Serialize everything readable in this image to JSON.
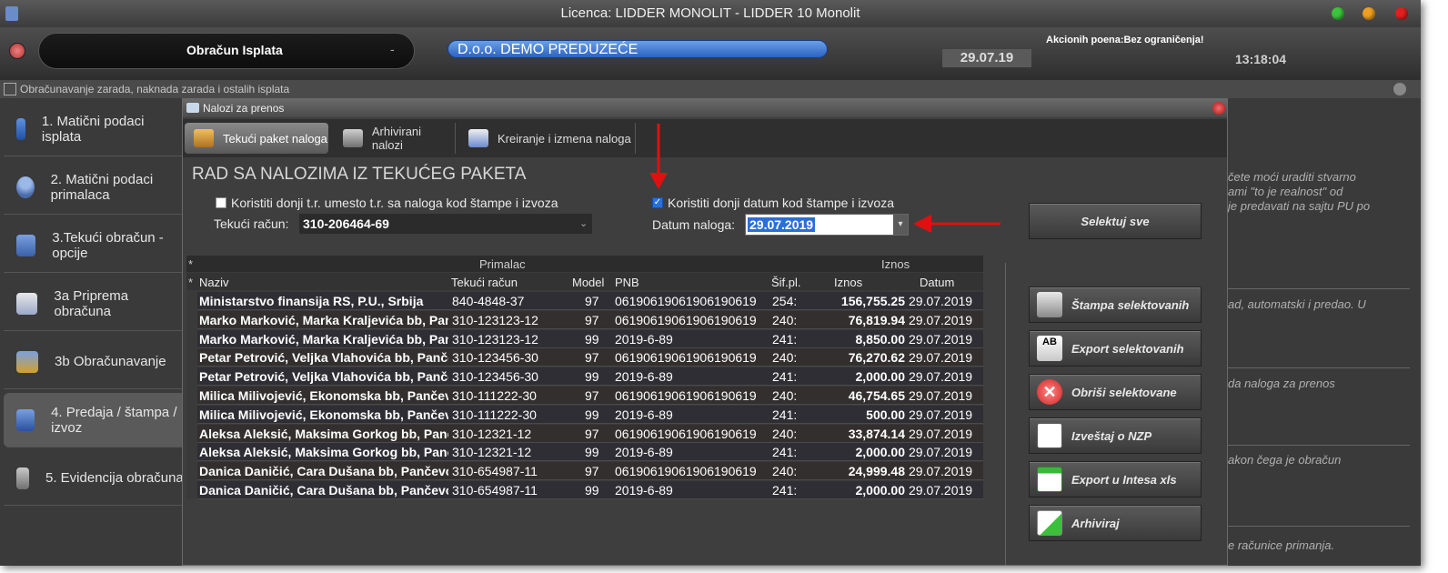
{
  "window": {
    "title": "Licenca: LIDDER MONOLIT - LIDDER 10 Monolit"
  },
  "toolbar": {
    "module": "Obračun Isplata",
    "module_dash": "-",
    "company": "D.o.o. DEMO PREDUZEĆE",
    "date": "29.07.19",
    "akcioni": "Akcionih poena:Bez ograničenja!",
    "clock": "13:18:04"
  },
  "subbar": {
    "title": "Obračunavanje zarada, naknada zarada i ostalih isplata"
  },
  "menu": {
    "items": [
      {
        "label": "1. Matični podaci isplata"
      },
      {
        "label": "2. Matični podaci primalaca"
      },
      {
        "label": "3.Tekući obračun - opcije"
      },
      {
        "label": "3a Priprema obračuna"
      },
      {
        "label": "3b Obračunavanje"
      },
      {
        "label": "4. Predaja / štampa / izvoz"
      },
      {
        "label": "5. Evidencija obračuna"
      }
    ]
  },
  "hints": [
    "čete moći uraditi stvarno",
    "ami \"to je realnost\" od",
    "je predavati na sajtu PU po",
    "ad, automatski i predao. U",
    "da naloga za prenos",
    "akon čega je obračun",
    "e računice primanja."
  ],
  "dialog": {
    "title": "Nalozi za prenos",
    "tabs": [
      {
        "label": "Tekući paket naloga"
      },
      {
        "label": "Arhivirani nalozi"
      },
      {
        "label": "Kreiranje i izmena naloga"
      }
    ],
    "section_title": "RAD SA NALOZIMA IZ TEKUĆEG PAKETA",
    "chk_account": "Koristiti donji t.r. umesto t.r. sa naloga kod štampe i izvoza",
    "chk_date": "Koristiti donji datum kod štampe i izvoza",
    "account_label": "Tekući račun:",
    "account_value": "310-206464-69",
    "date_label": "Datum naloga:",
    "date_value": "29.07.2019",
    "select_all": "Selektuj sve"
  },
  "grid": {
    "group_primalac": "Primalac",
    "group_iznos": "Iznos",
    "star": "*",
    "headers": {
      "naziv": "Naziv",
      "racun": "Tekući račun",
      "model": "Model",
      "pnb": "PNB",
      "sif": "Šif.pl.",
      "iznos": "Iznos",
      "datum": "Datum"
    },
    "rows": [
      {
        "naziv": "Ministarstvo finansija RS, P.U., Srbija",
        "racun": "840-4848-37",
        "model": "97",
        "pnb": "06190619061906190619",
        "sif": "254:",
        "iznos": "156,755.25",
        "datum": "29.07.2019"
      },
      {
        "naziv": "Marko Marković, Marka Kraljevića bb, Pančevo",
        "racun": "310-123123-12",
        "model": "97",
        "pnb": "06190619061906190619",
        "sif": "240:",
        "iznos": "76,819.94",
        "datum": "29.07.2019"
      },
      {
        "naziv": "Marko Marković, Marka Kraljevića bb, Pančevo",
        "racun": "310-123123-12",
        "model": "99",
        "pnb": "2019-6-89",
        "sif": "241:",
        "iznos": "8,850.00",
        "datum": "29.07.2019"
      },
      {
        "naziv": "Petar Petrović, Veljka Vlahovića bb, Pančevo",
        "racun": "310-123456-30",
        "model": "97",
        "pnb": "06190619061906190619",
        "sif": "240:",
        "iznos": "76,270.62",
        "datum": "29.07.2019"
      },
      {
        "naziv": "Petar Petrović, Veljka Vlahovića bb, Pančevo",
        "racun": "310-123456-30",
        "model": "99",
        "pnb": "2019-6-89",
        "sif": "241:",
        "iznos": "2,000.00",
        "datum": "29.07.2019"
      },
      {
        "naziv": "Milica Milivojević, Ekonomska bb, Pančevo",
        "racun": "310-111222-30",
        "model": "97",
        "pnb": "06190619061906190619",
        "sif": "240:",
        "iznos": "46,754.65",
        "datum": "29.07.2019"
      },
      {
        "naziv": "Milica Milivojević, Ekonomska bb, Pančevo",
        "racun": "310-111222-30",
        "model": "99",
        "pnb": "2019-6-89",
        "sif": "241:",
        "iznos": "500.00",
        "datum": "29.07.2019"
      },
      {
        "naziv": "Aleksa Aleksić, Maksima Gorkog bb, Pančevo",
        "racun": "310-12321-12",
        "model": "97",
        "pnb": "06190619061906190619",
        "sif": "240:",
        "iznos": "33,874.14",
        "datum": "29.07.2019"
      },
      {
        "naziv": "Aleksa Aleksić, Maksima Gorkog bb, Pančevo",
        "racun": "310-12321-12",
        "model": "99",
        "pnb": "2019-6-89",
        "sif": "241:",
        "iznos": "2,000.00",
        "datum": "29.07.2019"
      },
      {
        "naziv": "Danica Daničić, Cara Dušana bb, Pančevo",
        "racun": "310-654987-11",
        "model": "97",
        "pnb": "06190619061906190619",
        "sif": "240:",
        "iznos": "24,999.48",
        "datum": "29.07.2019"
      },
      {
        "naziv": "Danica Daničić, Cara Dušana bb, Pančevo",
        "racun": "310-654987-11",
        "model": "99",
        "pnb": "2019-6-89",
        "sif": "241:",
        "iznos": "2,000.00",
        "datum": "29.07.2019"
      }
    ]
  },
  "buttons": {
    "stampa": "Štampa selektovanih",
    "export": "Export selektovanih",
    "obrisi": "Obriši selektovane",
    "izvestaj": "Izveštaj o NZP",
    "intesa": "Export u Intesa xls",
    "arhiviraj": "Arhiviraj"
  },
  "colors": {
    "accent_red": "#e01010",
    "selection_blue": "#2a6fd8"
  }
}
